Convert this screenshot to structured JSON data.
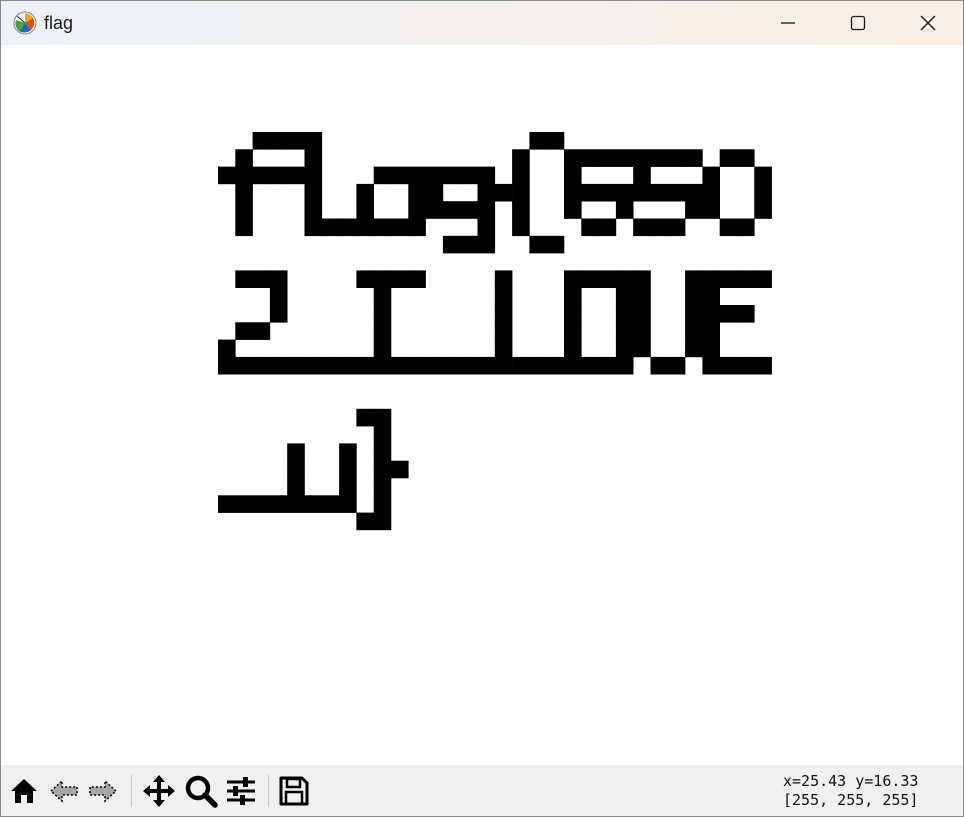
{
  "window": {
    "title": "flag",
    "app_icon": "matplotlib-icon",
    "controls": [
      "minimize",
      "maximize",
      "close"
    ]
  },
  "canvas": {
    "background": "#ffffff",
    "pixel_color": "#000000",
    "lines": [
      "flag{650",
      "2_I_LOVE",
      "_u}"
    ]
  },
  "toolbar": {
    "buttons": [
      {
        "name": "home",
        "icon": "home-icon"
      },
      {
        "name": "back",
        "icon": "arrow-left-icon"
      },
      {
        "name": "forward",
        "icon": "arrow-right-icon"
      },
      {
        "name": "pan",
        "icon": "move-icon"
      },
      {
        "name": "zoom",
        "icon": "magnifier-icon"
      },
      {
        "name": "configure-subplots",
        "icon": "sliders-icon"
      },
      {
        "name": "save",
        "icon": "floppy-disk-icon"
      }
    ]
  },
  "status": {
    "coords": "x=25.43 y=16.33",
    "pixel_value": "[255, 255, 255]"
  }
}
